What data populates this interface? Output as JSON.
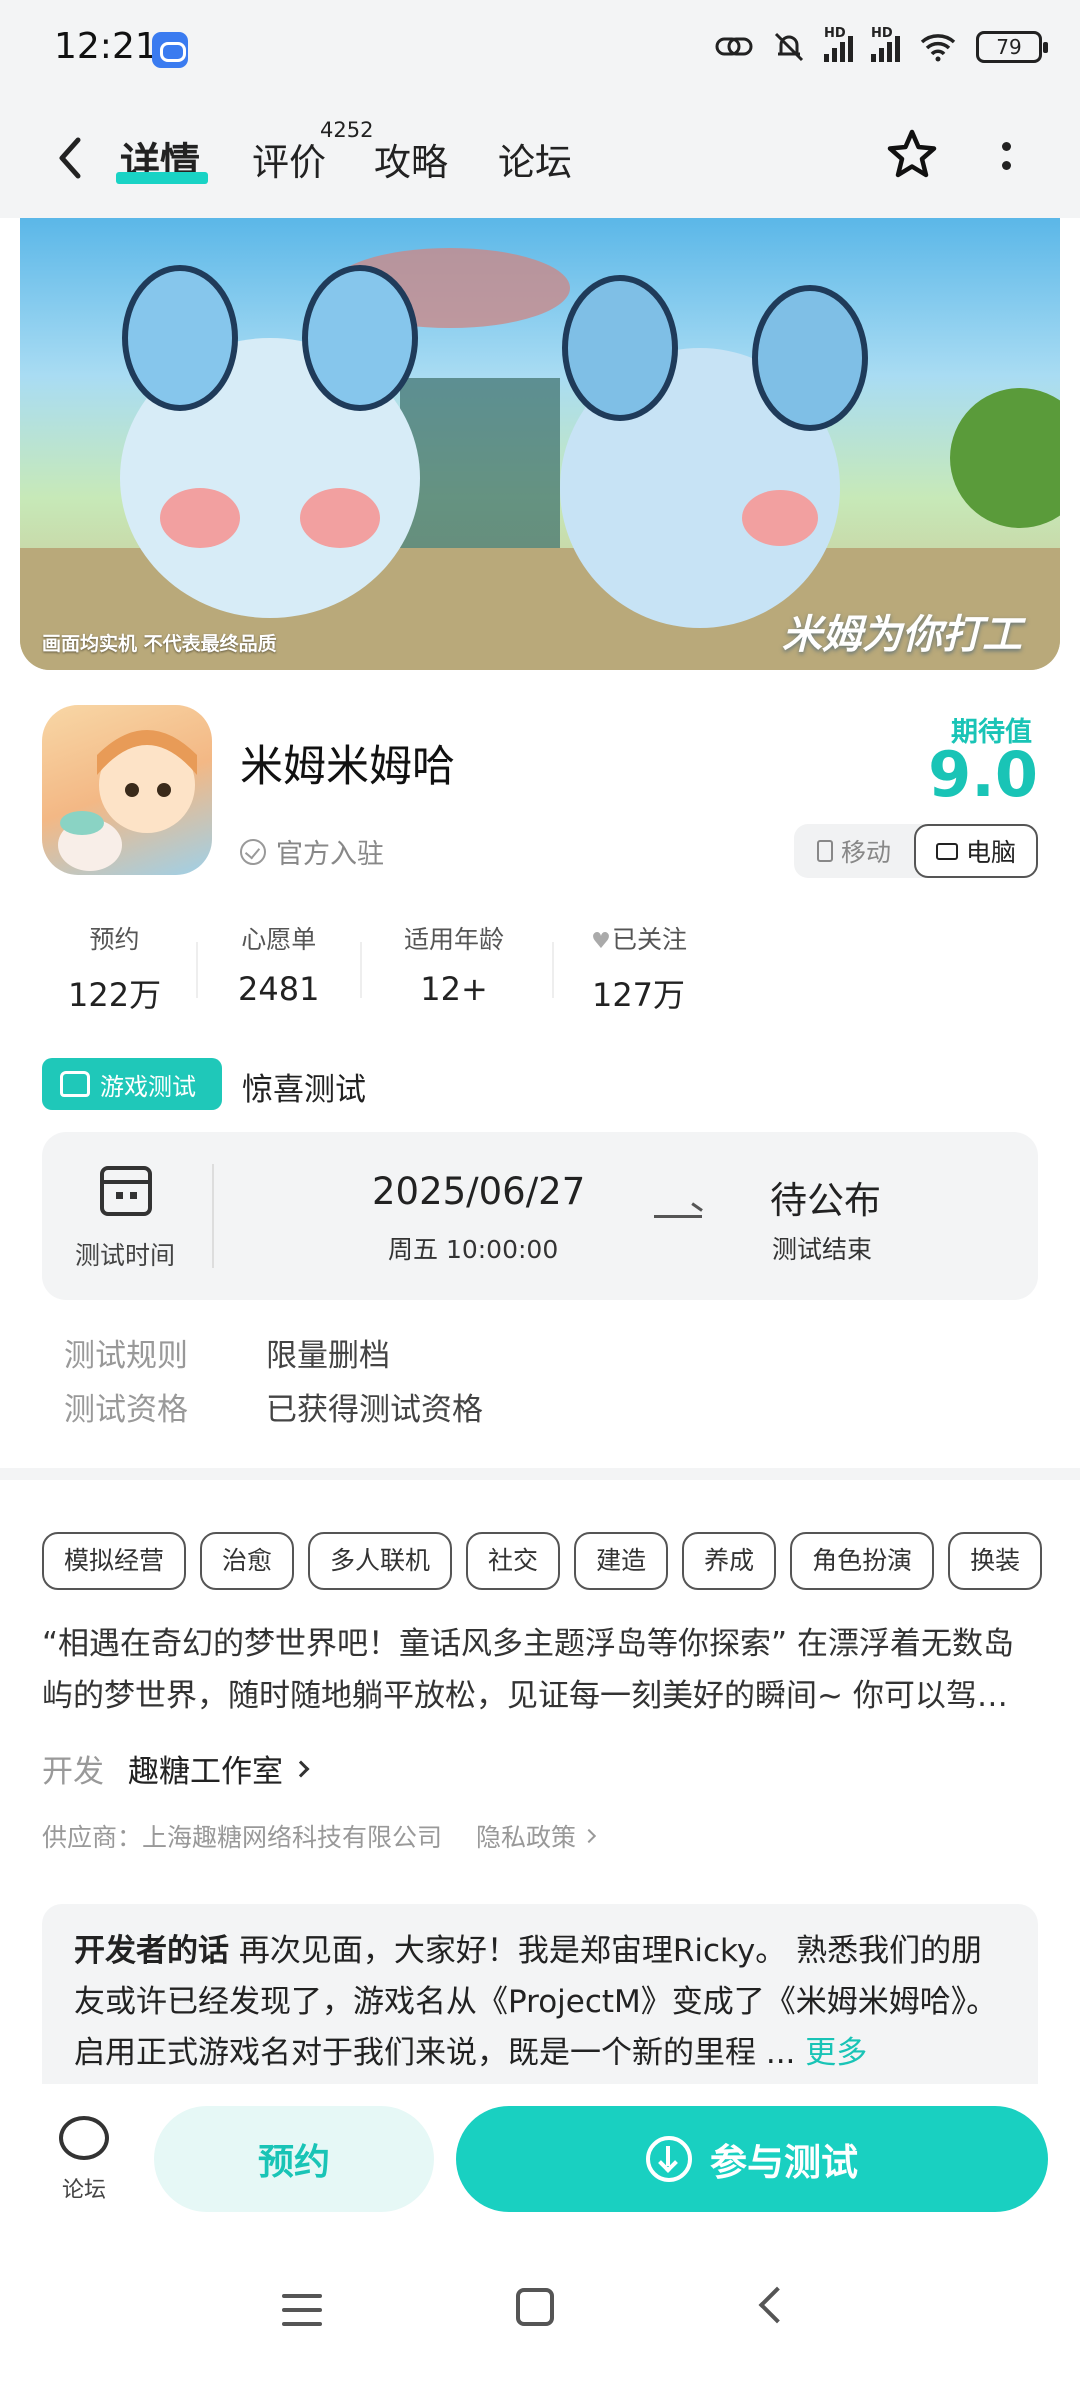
{
  "status": {
    "time": "12:21",
    "battery": "79",
    "hd": "HD"
  },
  "nav": {
    "tabs": [
      {
        "label": "详情"
      },
      {
        "label": "评价"
      },
      {
        "label": "攻略"
      },
      {
        "label": "论坛"
      }
    ],
    "review_count": "4252"
  },
  "banner": {
    "caption_left": "画面均实机 不代表最终品质",
    "caption_right": "米姆为你打工"
  },
  "game": {
    "name": "米姆米姆哈",
    "official": "官方入驻",
    "expect_label": "期待值",
    "expect_score": "9.0",
    "platforms": {
      "mobile": "移动",
      "pc": "电脑"
    }
  },
  "stats": [
    {
      "label": "预约",
      "value": "122万"
    },
    {
      "label": "心愿单",
      "value": "2481"
    },
    {
      "label": "适用年龄",
      "value": "12+"
    },
    {
      "label": "已关注",
      "value": "127万"
    }
  ],
  "test": {
    "badge": "游戏测试",
    "name": "惊喜测试",
    "time_label": "测试时间",
    "start_date": "2025/06/27",
    "start_time": "周五  10:00:00",
    "end_main": "待公布",
    "end_sub": "测试结束",
    "rules": [
      {
        "key": "测试规则",
        "value": "限量删档"
      },
      {
        "key": "测试资格",
        "value": "已获得测试资格"
      }
    ]
  },
  "tags": [
    "模拟经营",
    "治愈",
    "多人联机",
    "社交",
    "建造",
    "养成",
    "角色扮演",
    "换装"
  ],
  "description": "“相遇在奇幻的梦世界吧！童话风多主题浮岛等你探索” 在漂浮着无数岛屿的梦世界，随时随地躺平放松，见证每一刻美好的瞬间~ 你可以驾…",
  "developer": {
    "label": "开发",
    "name": "趣糖工作室"
  },
  "supplier": "供应商：上海趣糖网络科技有限公司",
  "privacy": "隐私政策",
  "dev_words": {
    "label": "开发者的话",
    "text": "再次见面，大家好！我是郑宙理Ricky。 熟悉我们的朋友或许已经发现了，游戏名从《ProjectM》变成了《米姆米姆哈》。启用正式游戏名对于我们来说，既是一个新的里程 ...",
    "more": "更多"
  },
  "bottom": {
    "forum": "论坛",
    "reserve": "预约",
    "join": "参与测试"
  },
  "colors": {
    "accent": "#19d0c1",
    "accent_text": "#19c4b6"
  }
}
